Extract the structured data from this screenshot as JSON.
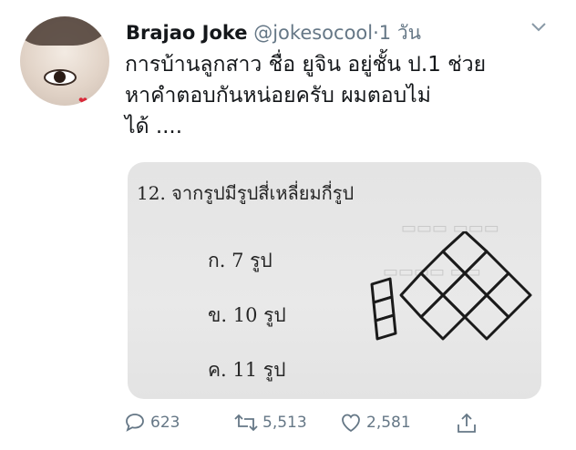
{
  "tweet": {
    "name": "Brajao Joke",
    "handle": "@jokesocool",
    "separator": "·",
    "time": "1 วัน",
    "text_lines": [
      "การบ้านลูกสาว ชื่อ ยูจิน อยู่ชั้น ป.1 ช่วย",
      "หาคำตอบกันหน่อยครับ ผมตอบไม่",
      "ได้ ...."
    ]
  },
  "worksheet": {
    "question": "12. จากรูปมีรูปสี่เหลี่ยมกี่รูป",
    "choices": [
      "ก.  7 รูป",
      "ข. 10 รูป",
      "ค. 11 รูป"
    ]
  },
  "actions": {
    "replies": "623",
    "retweets": "5,513",
    "likes": "2,581"
  },
  "colors": {
    "text": "#14171a",
    "secondary": "#657786",
    "accent_heart": "#d92a3a"
  },
  "icons": [
    "reply-icon",
    "retweet-icon",
    "like-icon",
    "share-icon",
    "chevron-down-icon"
  ]
}
